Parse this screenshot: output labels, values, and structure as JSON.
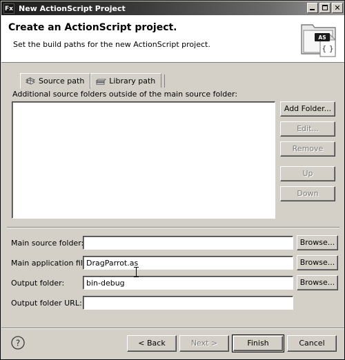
{
  "window": {
    "app_icon": "fx-icon",
    "app_icon_label": "Fx",
    "title": "New ActionScript Project",
    "controls": {
      "minimize": "minimize-button",
      "maximize": "maximize-button",
      "close": "close-button",
      "close_label": "✕"
    }
  },
  "header": {
    "title": "Create an ActionScript project.",
    "subtitle": "Set the build paths for the new ActionScript project.",
    "icon": "actionscript-project-folder-icon",
    "icon_badge": "AS",
    "icon_doc_glyph": "{ }"
  },
  "tabs": [
    {
      "label": "Source path",
      "icon": "source-path-icon",
      "active": true
    },
    {
      "label": "Library path",
      "icon": "library-path-icon",
      "active": false
    }
  ],
  "source_path_panel": {
    "list_label": "Additional source folders outside of the main source folder:",
    "list_items": [],
    "buttons": [
      {
        "label": "Add Folder...",
        "enabled": true
      },
      {
        "label": "Edit...",
        "enabled": false
      },
      {
        "label": "Remove",
        "enabled": false
      },
      {
        "label": "Up",
        "enabled": false
      },
      {
        "label": "Down",
        "enabled": false
      }
    ]
  },
  "form": {
    "rows": [
      {
        "label": "Main source folder:",
        "value": "",
        "placeholder": "",
        "browse_label": "Browse...",
        "has_browse": true
      },
      {
        "label": "Main application file:",
        "value": "DragParrot.as",
        "placeholder": "",
        "browse_label": "Browse...",
        "has_browse": true
      },
      {
        "label": "Output folder:",
        "value": "bin-debug",
        "placeholder": "",
        "browse_label": "Browse...",
        "has_browse": true
      },
      {
        "label": "Output folder URL:",
        "value": "",
        "placeholder": "",
        "browse_label": "",
        "has_browse": false
      }
    ]
  },
  "footer": {
    "help_icon": "help-question-icon",
    "buttons": [
      {
        "label": "< Back",
        "enabled": true,
        "default": false
      },
      {
        "label": "Next >",
        "enabled": false,
        "default": false
      },
      {
        "label": "Finish",
        "enabled": true,
        "default": true
      },
      {
        "label": "Cancel",
        "enabled": true,
        "default": false
      }
    ]
  },
  "colors": {
    "face": "#d4d0c8",
    "field": "#ffffff",
    "disabled_text": "#808080",
    "titlebar_dark": "#1d1d1d"
  }
}
